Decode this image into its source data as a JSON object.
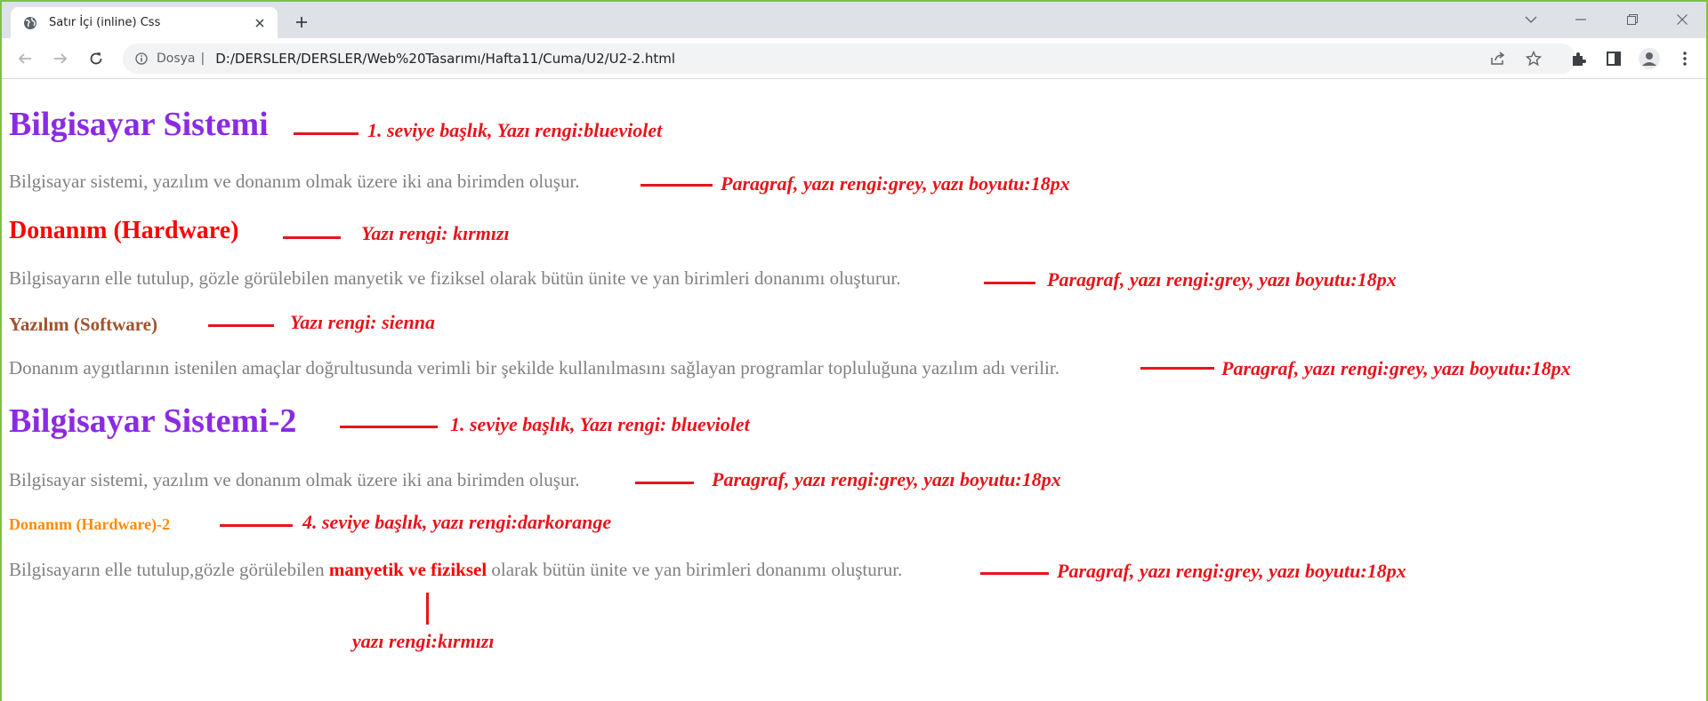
{
  "browser": {
    "tab_title": "Satır İçi (inline) Css",
    "site_label": "Dosya",
    "separator": "|",
    "url": "D:/DERSLER/DERSLER/Web%20Tasarımı/Hafta11/Cuma/U2/U2-2.html",
    "icons": [
      "globe-icon",
      "close-icon",
      "plus-icon",
      "chevron-down-icon",
      "minimize-icon",
      "restore-icon",
      "close-window-icon",
      "back-icon",
      "forward-icon",
      "reload-icon",
      "info-icon",
      "share-icon",
      "star-icon",
      "extensions-icon",
      "side-panel-icon",
      "profile-icon",
      "more-icon"
    ]
  },
  "content": {
    "h1_first": "Bilgisayar Sistemi",
    "note_h1_first": "1. seviye başlık, Yazı rengi:blueviolet",
    "p1": "Bilgisayar sistemi, yazılım ve donanım olmak üzere iki ana birimden oluşur.",
    "note_p1": "Paragraf, yazı rengi:grey, yazı boyutu:18px",
    "h2": "Donanım (Hardware)",
    "note_h2": "Yazı rengi: kırmızı",
    "p2": "Bilgisayarın elle tutulup, gözle görülebilen manyetik ve fiziksel olarak bütün ünite ve yan birimleri donanımı oluşturur.",
    "note_p2": "Paragraf, yazı rengi:grey, yazı boyutu:18px",
    "h3": "Yazılım (Software)",
    "note_h3": "Yazı rengi: sienna",
    "p3": "Donanım aygıtlarının istenilen amaçlar doğrultusunda verimli bir şekilde kullanılmasını sağlayan programlar topluluğuna yazılım adı verilir.",
    "note_p3": "Paragraf, yazı rengi:grey, yazı boyutu:18px",
    "h1_second": "Bilgisayar Sistemi-2",
    "note_h1_second": "1. seviye başlık, Yazı rengi: blueviolet",
    "p4": "Bilgisayar sistemi, yazılım ve donanım olmak üzere iki ana birimden oluşur.",
    "note_p4": "Paragraf, yazı rengi:grey, yazı boyutu:18px",
    "h4": "Donanım (Hardware)-2",
    "note_h4": "4. seviye başlık, yazı rengi:darkorange",
    "p5_before": "Bilgisayarın elle tutulup,gözle görülebilen ",
    "p5_red": "manyetik ve fiziksel",
    "p5_after": " olarak bütün ünite ve yan birimleri donanımı oluşturur.",
    "note_p5": "Paragraf, yazı rengi:grey, yazı boyutu:18px",
    "note_inline_red": "yazı rengi:kırmızı"
  },
  "colors": {
    "h1": "blueviolet",
    "paragraph": "grey",
    "h2": "red",
    "h3": "sienna",
    "h4": "darkorange",
    "annotation": "#e8141c",
    "window_border": "#7dc242"
  }
}
